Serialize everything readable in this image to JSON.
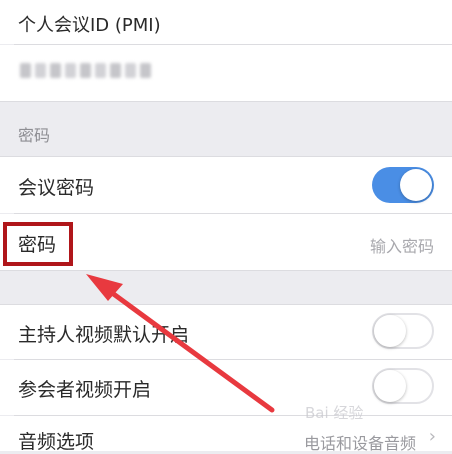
{
  "pmi": {
    "label": "个人会议ID (PMI)"
  },
  "password_section": {
    "title": "密码",
    "meeting_password_label": "会议密码",
    "meeting_password_on": true,
    "password_label": "密码",
    "password_placeholder": "输入密码"
  },
  "video": {
    "host_video_label": "主持人视频默认开启",
    "host_video_on": false,
    "participant_video_label": "参会者视频开启",
    "participant_video_on": false
  },
  "audio": {
    "label": "音频选项",
    "value": "电话和设备音频"
  },
  "watermark": {
    "text": "Bai 经验"
  },
  "colors": {
    "toggle_on": "#4a8ee5",
    "highlight_box": "#b0161a",
    "arrow": "#e8393f"
  }
}
